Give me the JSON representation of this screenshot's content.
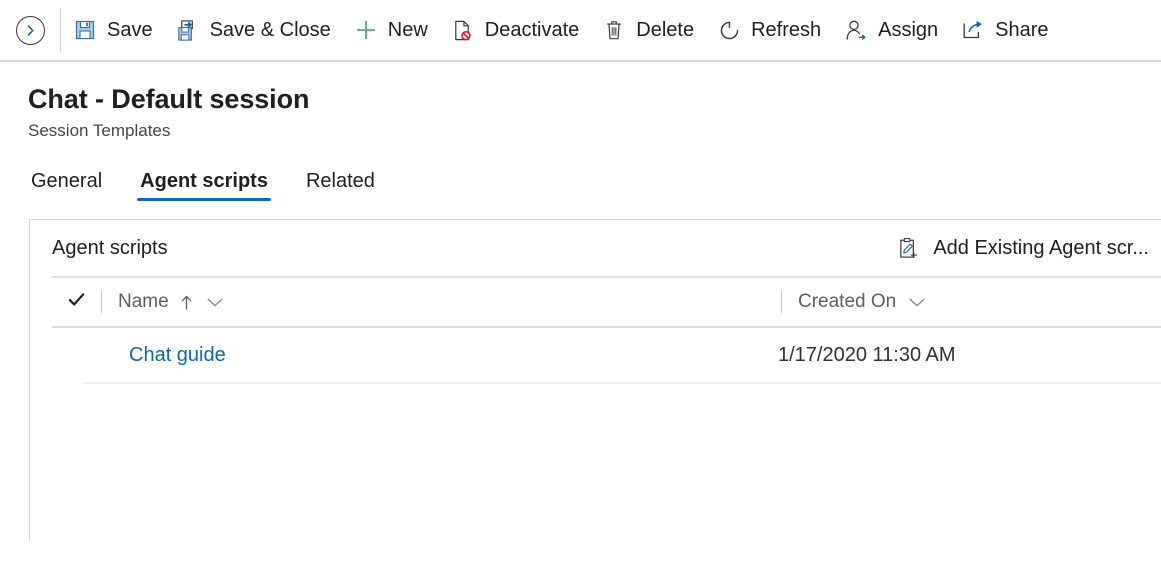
{
  "commandbar": {
    "back": {
      "name": "back-button",
      "icon": "chevron-right-circle-icon"
    },
    "items": [
      {
        "label": "Save",
        "icon": "save-floppy-icon"
      },
      {
        "label": "Save & Close",
        "icon": "save-and-close-icon"
      },
      {
        "label": "New",
        "icon": "plus-icon"
      },
      {
        "label": "Deactivate",
        "icon": "deactivate-icon"
      },
      {
        "label": "Delete",
        "icon": "trash-icon"
      },
      {
        "label": "Refresh",
        "icon": "refresh-icon"
      },
      {
        "label": "Assign",
        "icon": "assign-person-icon"
      },
      {
        "label": "Share",
        "icon": "share-icon"
      }
    ]
  },
  "header": {
    "title": "Chat - Default session",
    "subtitle": "Session Templates"
  },
  "tabs": [
    {
      "label": "General",
      "selected": false
    },
    {
      "label": "Agent scripts",
      "selected": true
    },
    {
      "label": "Related",
      "selected": false
    }
  ],
  "card": {
    "title": "Agent scripts",
    "action_label": "Add Existing Agent scr...",
    "action_icon": "clipboard-add-icon"
  },
  "grid": {
    "select_all_icon": "checkmark-icon",
    "columns": [
      {
        "label": "Name",
        "sort": "ascending",
        "sort_icon": "arrow-up-icon",
        "menu_icon": "chevron-down-icon"
      },
      {
        "label": "Created On",
        "sort": "none",
        "menu_icon": "chevron-down-icon"
      }
    ],
    "rows": [
      {
        "name": "Chat guide",
        "created_on": "1/17/2020 11:30 AM"
      }
    ]
  },
  "colors": {
    "accent": "#0f6cbd",
    "link": "#1264a3",
    "new_green": "#4caf7d",
    "delete_red": "#e81123",
    "text": "#201f1e",
    "muted": "#605e5c",
    "border": "#d6d6d6"
  }
}
